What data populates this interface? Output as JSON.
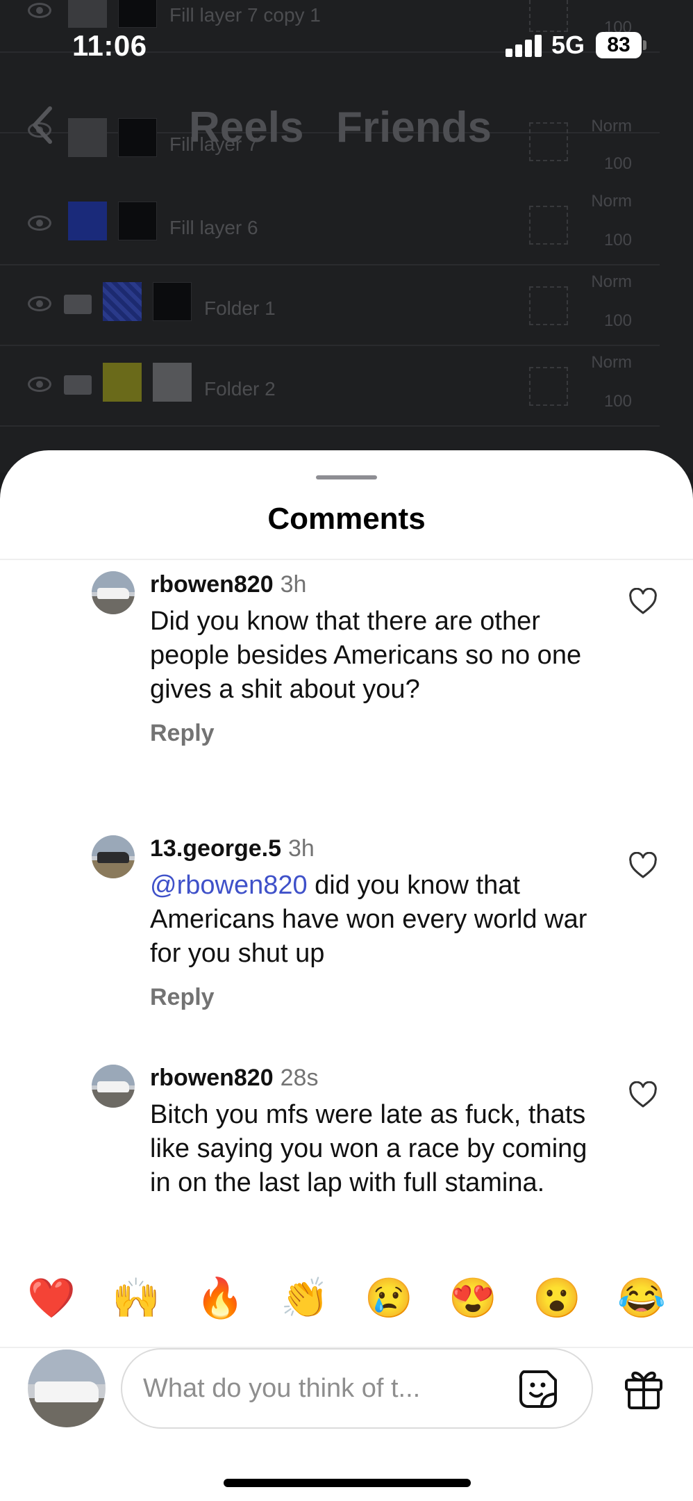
{
  "status_bar": {
    "time": "11:06",
    "network": "5G",
    "battery": "83"
  },
  "header": {
    "tabs": [
      {
        "label": "Reels"
      },
      {
        "label": "Friends"
      }
    ]
  },
  "background_layers": [
    {
      "name": "Fill layer 7 copy 1",
      "blend": "",
      "opacity": "100"
    },
    {
      "name": "Fill layer 7",
      "blend": "Norm",
      "opacity": "100"
    },
    {
      "name": "Fill layer 6",
      "blend": "Norm",
      "opacity": "100"
    },
    {
      "name": "Folder 1",
      "blend": "Norm",
      "opacity": "100"
    },
    {
      "name": "Folder 2",
      "blend": "Norm",
      "opacity": "100"
    }
  ],
  "comments_sheet": {
    "title": "Comments",
    "comments": [
      {
        "username": "rbowen820",
        "time_ago": "3h",
        "mention": "",
        "text": "Did you know that there are other people besides Americans so no one gives a shit about you?",
        "reply_label": "Reply"
      },
      {
        "username": "13.george.5",
        "time_ago": "3h",
        "mention": "@rbowen820",
        "text": " did you know that Americans have won every world war for you shut up",
        "reply_label": "Reply"
      },
      {
        "username": "rbowen820",
        "time_ago": "28s",
        "mention": "",
        "text": "Bitch you mfs were late as fuck, thats like saying you won a race by coming in on the last lap with full stamina.",
        "reply_label": ""
      }
    ]
  },
  "composer": {
    "emoji_reactions": [
      "❤️",
      "🙌",
      "🔥",
      "👏",
      "😢",
      "😍",
      "😮",
      "😂"
    ],
    "placeholder": "What do you think of t...",
    "icons": {
      "sticker": "sticker-icon",
      "gift": "gift-icon"
    }
  }
}
